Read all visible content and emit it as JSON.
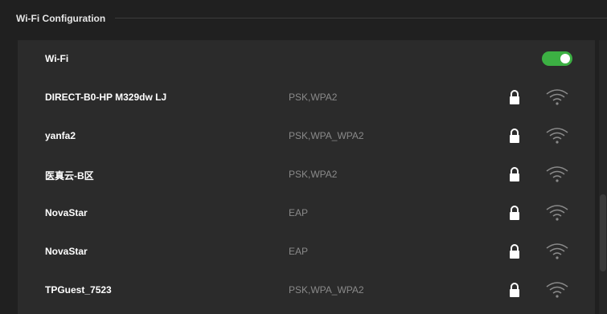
{
  "section": {
    "title": "Wi-Fi Configuration"
  },
  "wifi": {
    "label": "Wi-Fi",
    "enabled": true,
    "toggle_color": "#3cb043"
  },
  "icons": {
    "lock": "lock-icon",
    "signal": "wifi-signal-icon"
  },
  "networks": [
    {
      "name": "DIRECT-B0-HP M329dw LJ",
      "security": "PSK,WPA2"
    },
    {
      "name": "yanfa2",
      "security": "PSK,WPA_WPA2"
    },
    {
      "name": "医真云-B区",
      "security": "PSK,WPA2"
    },
    {
      "name": "NovaStar",
      "security": "EAP"
    },
    {
      "name": "NovaStar",
      "security": "EAP"
    },
    {
      "name": "TPGuest_7523",
      "security": "PSK,WPA_WPA2"
    }
  ]
}
